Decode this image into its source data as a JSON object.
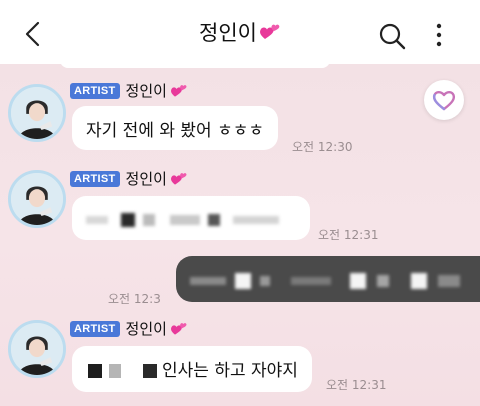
{
  "header": {
    "title": "정인이",
    "back_icon": "chevron-left-icon",
    "search_icon": "search-icon",
    "more_icon": "more-vertical-icon"
  },
  "fab": {
    "icon": "heart-outline-icon",
    "color": "#c873b8"
  },
  "colors": {
    "badge": "#4a78d8",
    "background": "#f4e2e6",
    "self_bubble": "#4a4a4a"
  },
  "messages": [
    {
      "badge": "ARTIST",
      "sender": "정인이",
      "text": "자기 전에 와 봤어 ㅎㅎㅎ",
      "time": "오전 12:30"
    },
    {
      "badge": "ARTIST",
      "sender": "정인이",
      "text": "",
      "time": "오전 12:31"
    },
    {
      "self": true,
      "text": "",
      "time": "오전 12:3"
    },
    {
      "badge": "ARTIST",
      "sender": "정인이",
      "text": "인사는 하고 자야지",
      "time": "오전 12:31"
    }
  ]
}
